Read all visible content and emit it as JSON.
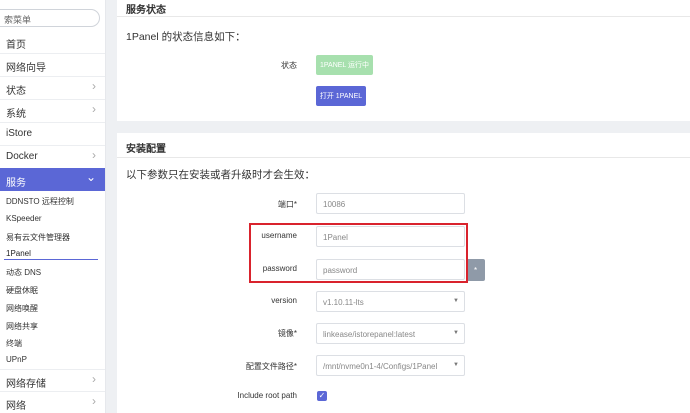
{
  "sidebar": {
    "search_text": "索菜单",
    "items": [
      {
        "label": "首页",
        "chevron": false
      },
      {
        "label": "网络向导",
        "chevron": false
      },
      {
        "label": "状态",
        "chevron": true
      },
      {
        "label": "系统",
        "chevron": true
      },
      {
        "label": "iStore",
        "chevron": false
      },
      {
        "label": "Docker",
        "chevron": true
      },
      {
        "label": "服务",
        "chevron": true
      }
    ],
    "chevron_right": "›",
    "chevron_down": "⌄",
    "subitems": [
      "DDNSTO 远程控制",
      "KSpeeder",
      "易有云文件管理器",
      "1Panel",
      "动态 DNS",
      "硬盘休眠",
      "网络唤醒",
      "网络共享",
      "终端",
      "UPnP"
    ],
    "bottom_items": [
      {
        "label": "网络存储"
      },
      {
        "label": "网络"
      }
    ],
    "accent_color": "#5b67d6"
  },
  "status_section": {
    "title": "服务状态",
    "description": "1Panel 的状态信息如下：",
    "status_label": "状态",
    "status_button": "1PANEL 运行中",
    "open_button": "打开 1PANEL",
    "status_color": "#a7e0ae"
  },
  "install_section": {
    "title": "安装配置",
    "description": "以下参数只在安装或者升级时才会生效：",
    "fields": {
      "port": {
        "label": "端口*",
        "value": "10086"
      },
      "username": {
        "label": "username",
        "value": "1Panel"
      },
      "password": {
        "label": "password",
        "placeholder": "password"
      },
      "version": {
        "label": "version",
        "value": "v1.10.11-lts"
      },
      "image": {
        "label": "镜像*",
        "value": "linkease/istorepanel:latest"
      },
      "config_path": {
        "label": "配置文件路径*",
        "value": "/mnt/nvme0n1-4/Configs/1Panel"
      },
      "include_root": {
        "label": "Include root path",
        "checked": true
      }
    },
    "password_toggle": "*",
    "highlight_color": "#d9232d"
  }
}
